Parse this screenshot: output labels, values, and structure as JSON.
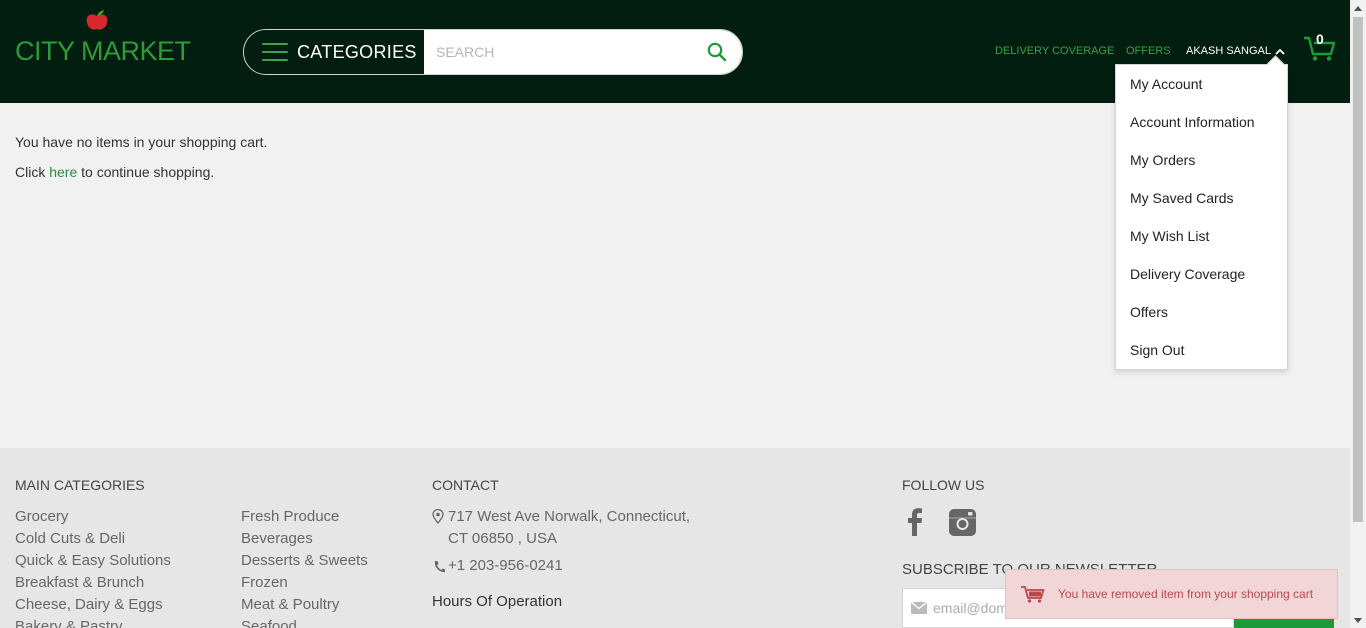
{
  "brand": {
    "logo_text": "CITY MARKET",
    "accent": "#2f9a3a",
    "header_bg": "#021e10"
  },
  "header": {
    "categories_label": "CATEGORIES",
    "search_placeholder": "SEARCH",
    "nav": {
      "delivery": "DELIVERY COVERAGE",
      "offers": "OFFERS",
      "user": "AKASH SANGAL"
    },
    "cart_count": "0"
  },
  "account_menu": {
    "items": [
      {
        "label": "My Account"
      },
      {
        "label": "Account Information"
      },
      {
        "label": "My Orders"
      },
      {
        "label": "My Saved Cards"
      },
      {
        "label": "My Wish List"
      },
      {
        "label": "Delivery Coverage"
      },
      {
        "label": "Offers"
      },
      {
        "label": "Sign Out"
      }
    ]
  },
  "main": {
    "empty_text": "You have no items in your shopping cart.",
    "click_prefix": "Click ",
    "here_link": "here",
    "click_suffix": " to continue shopping."
  },
  "footer": {
    "main_categories_title": "MAIN CATEGORIES",
    "col1": [
      "Grocery",
      "Cold Cuts & Deli",
      "Quick & Easy Solutions",
      "Breakfast & Brunch",
      "Cheese, Dairy & Eggs",
      "Bakery & Pastry"
    ],
    "col2": [
      "Fresh Produce",
      "Beverages",
      "Desserts & Sweets",
      "Frozen",
      "Meat & Poultry",
      "Seafood"
    ],
    "contact_title": "CONTACT",
    "address_line1": "717 West Ave Norwalk, Connecticut,",
    "address_line2": "CT 06850 , USA",
    "phone": "+1 203-956-0241",
    "hours_title": "Hours Of Operation",
    "follow_title": "FOLLOW US",
    "newsletter_title": "SUBSCRIBE TO OUR NEWSLETTER",
    "email_placeholder": "email@domain.com"
  },
  "toast": {
    "message": "You have removed item from your shopping cart"
  }
}
